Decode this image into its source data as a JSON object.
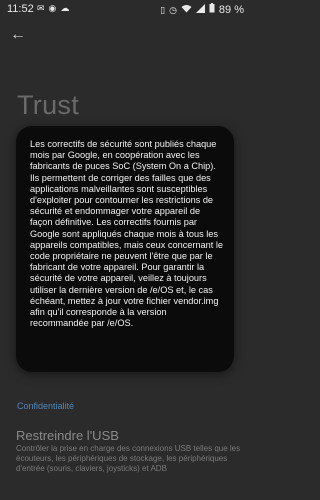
{
  "status_bar": {
    "time": "11:52",
    "battery": "89 %",
    "icons_left": [
      "mail-icon",
      "signal-icon",
      "cloud-icon"
    ],
    "icons_right": [
      "vibrate-icon",
      "alarm-icon",
      "wifi-icon",
      "cellular-icon",
      "battery-icon"
    ]
  },
  "page": {
    "title": "Trust"
  },
  "section": {
    "privacy_header": "Confidentialité"
  },
  "usb": {
    "title": "Restreindre l'USB",
    "description": "Contrôler la prise en charge des connexions USB telles que les écouteurs, les périphériques de stockage, les périphériques d'entrée (souris, claviers, joysticks) et ADB"
  },
  "dialog": {
    "text": "Les correctifs de sécurité sont publiés chaque mois par Google, en coopération avec les fabricants de puces SoC (System On a Chip). Ils permettent de corriger des failles que des applications malveillantes sont susceptibles d'exploiter pour contourner les restrictions de sécurité et endommager votre appareil de façon définitive. Les correctifs fournis par Google sont appliqués chaque mois à tous les appareils compatibles, mais ceux concernant le code propriétaire ne peuvent l'être que par le fabricant de votre appareil. Pour garantir la sécurité de votre appareil, veillez à toujours utiliser la dernière version de /e/OS et, le cas échéant, mettez à jour votre fichier vendor.img afin qu'il corresponde à la version recommandée par /e/OS."
  }
}
